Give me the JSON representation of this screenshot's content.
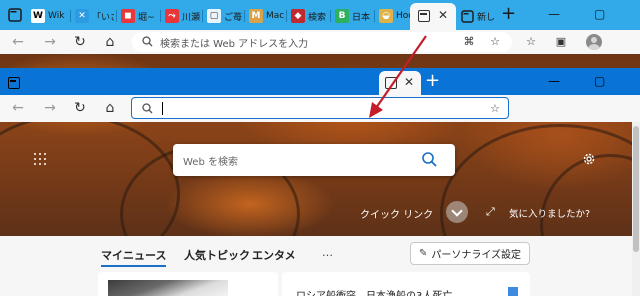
{
  "outer_browser": {
    "tabs": [
      {
        "label": "Wik",
        "fav_text": "W",
        "fav_color": "#ffffff",
        "fav_text_color": "#000000"
      },
      {
        "label": "「いさ",
        "fav_text": "✕",
        "fav_color": "#2d9be0",
        "fav_text_color": "#ffffff"
      },
      {
        "label": "堀~",
        "fav_text": "◼",
        "fav_color": "#e8363b",
        "fav_text_color": "#ffffff"
      },
      {
        "label": "川瀬",
        "fav_text": "⤳",
        "fav_color": "#e8363b",
        "fav_text_color": "#ffffff"
      },
      {
        "label": "ご苺",
        "fav_text": "▢",
        "fav_color": "#eaf4fb",
        "fav_text_color": "#333333"
      },
      {
        "label": "Mac",
        "fav_text": "M",
        "fav_color": "#d9a24a",
        "fav_text_color": "#ffffff"
      },
      {
        "label": "検索",
        "fav_text": "◆",
        "fav_color": "#c0292d",
        "fav_text_color": "#ffffff"
      },
      {
        "label": "日本",
        "fav_text": "B",
        "fav_color": "#2eb05c",
        "fav_text_color": "#ffffff"
      },
      {
        "label": "Hoc",
        "fav_text": "◒",
        "fav_color": "#e0b24a",
        "fav_text_color": "#ffffff"
      }
    ],
    "next_tab_label": "新し",
    "new_tab_symbol": "+",
    "close_symbol": "✕",
    "window_controls": {
      "minimize": "—",
      "maximize": "▢"
    },
    "address_placeholder": "検索または Web アドレスを入力",
    "nav": {
      "back": "←",
      "forward": "→",
      "refresh": "↻",
      "home": "⌂"
    },
    "toolbar_icons": {
      "extensions": "⌘",
      "favorites": "☆",
      "collections": "▣"
    }
  },
  "inner_browser": {
    "new_tab_symbol": "+",
    "close_symbol": "✕",
    "window_controls": {
      "minimize": "—",
      "maximize": "▢"
    },
    "address_value": "",
    "nav": {
      "back": "←",
      "forward": "→",
      "refresh": "↻",
      "home": "⌂"
    },
    "favorites_star": "☆"
  },
  "new_tab_page": {
    "search_placeholder": "Web を検索",
    "quick_links_label": "クイック リンク",
    "like_prompt": "気に入りましたか?",
    "feed_tabs": [
      {
        "label": "マイニュース",
        "active": true
      },
      {
        "label": "人気トピック",
        "active": false
      },
      {
        "label": "エンタメ",
        "active": false
      }
    ],
    "more_label": "…",
    "personalize_label": "パーソナライズ設定",
    "news_headline": "ロシア船衝突、日本漁船の3人死亡"
  },
  "colors": {
    "outer_tabbar": "#32a9e8",
    "inner_tabbar": "#0a74d6",
    "address_focus": "#1a6fc8",
    "arrow": "#c41e2a"
  }
}
